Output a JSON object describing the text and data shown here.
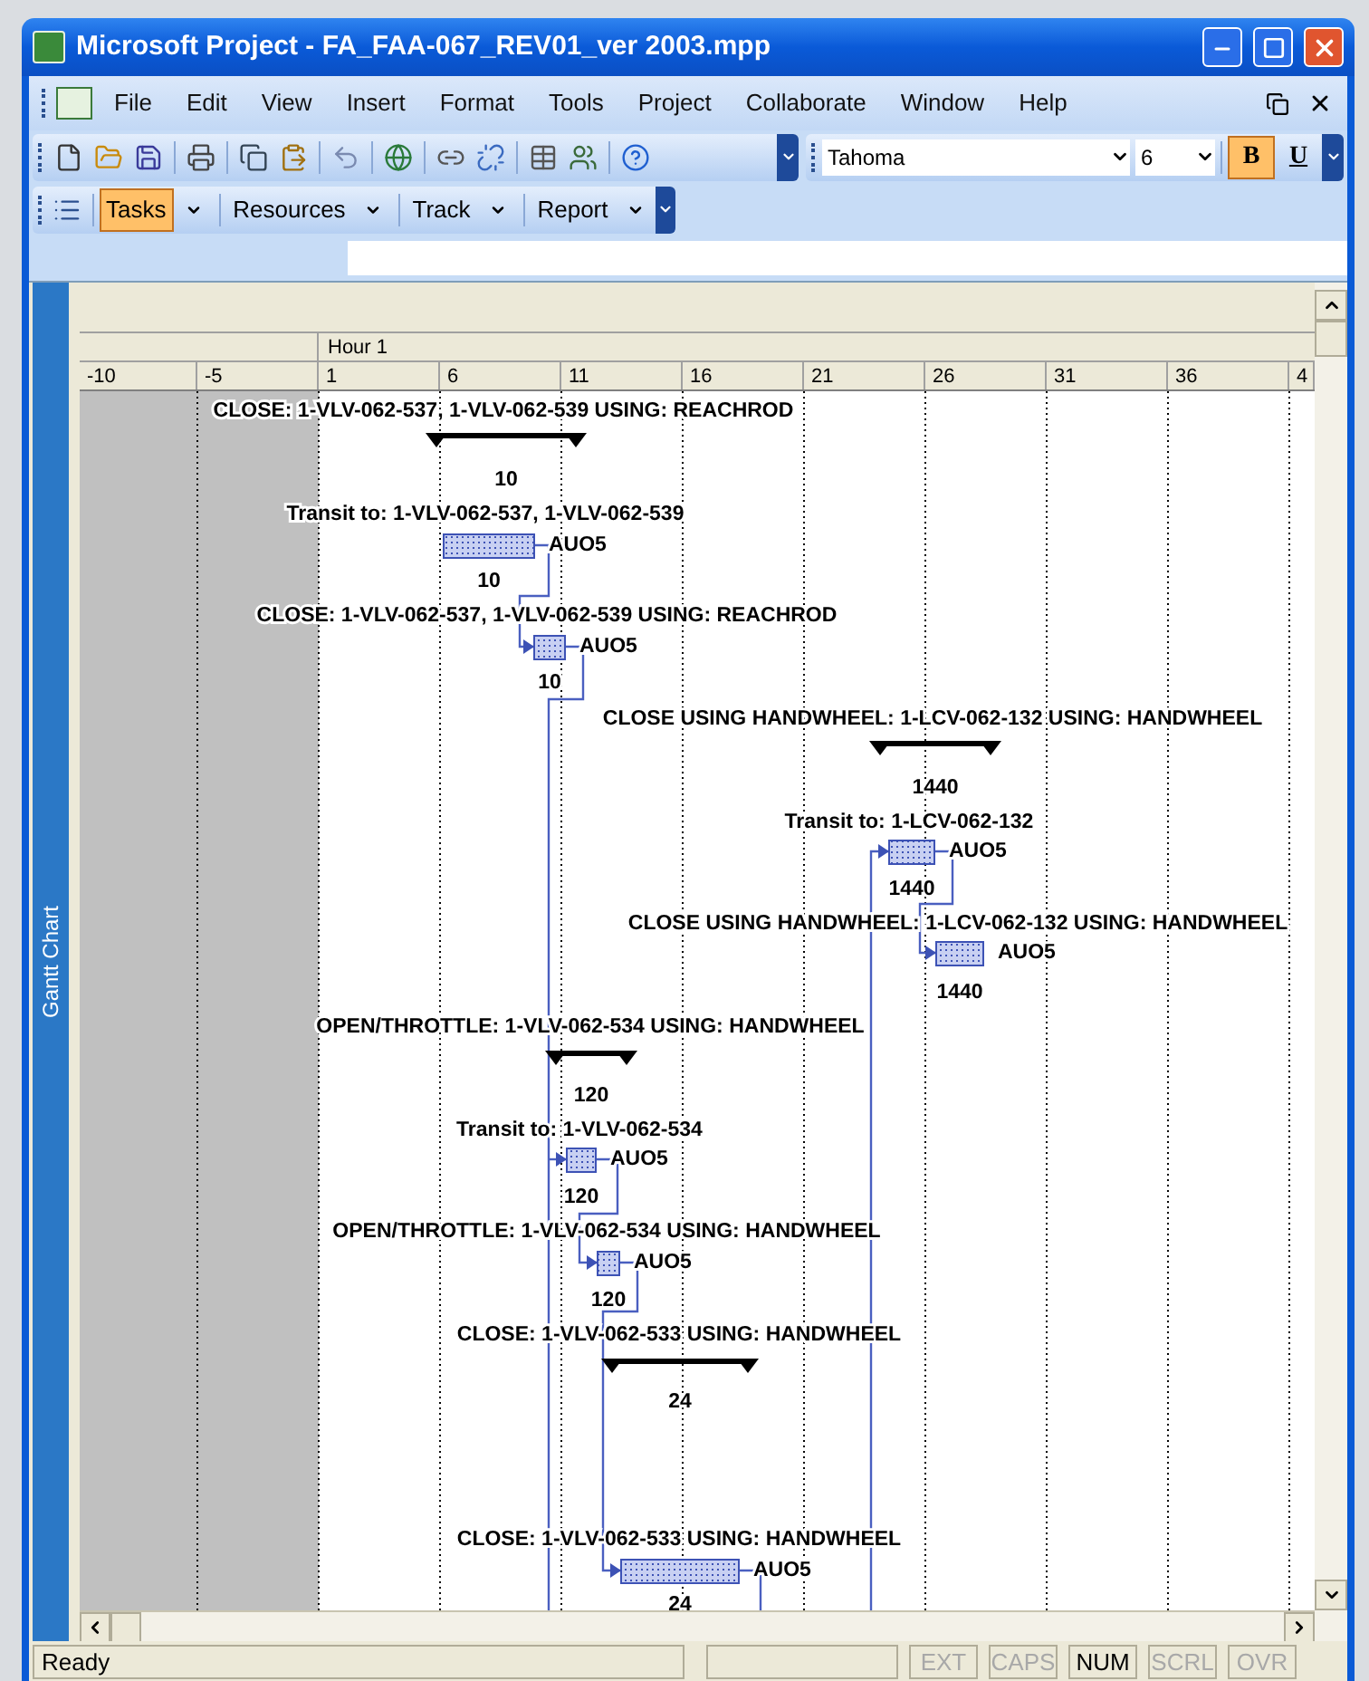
{
  "window": {
    "title": "Microsoft Project - FA_FAA-067_REV01_ver 2003.mpp"
  },
  "menu": [
    "File",
    "Edit",
    "View",
    "Insert",
    "Format",
    "Tools",
    "Project",
    "Collaborate",
    "Window",
    "Help"
  ],
  "formatting": {
    "font": "Tahoma",
    "size": "6",
    "buttons": [
      {
        "label": "B",
        "selected": true
      },
      {
        "label": "U",
        "selected": false
      }
    ]
  },
  "guide_bar": [
    {
      "label": "Tasks",
      "selected": true
    },
    {
      "label": "Resources",
      "selected": false
    },
    {
      "label": "Track",
      "selected": false
    },
    {
      "label": "Report",
      "selected": false
    }
  ],
  "view_label": "Gantt Chart",
  "timescale": {
    "middle_tier": "Hour 1",
    "ticks": [
      "-10",
      "-5",
      "1",
      "6",
      "11",
      "16",
      "21",
      "26",
      "31",
      "36",
      "4"
    ]
  },
  "tasks": [
    {
      "kind": "summary",
      "name": "CLOSE: 1-VLV-062-537, 1-VLV-062-539 USING: REACHROD",
      "duration": "10"
    },
    {
      "kind": "task",
      "name": "Transit to: 1-VLV-062-537, 1-VLV-062-539",
      "duration": "10",
      "resource": "AUO5"
    },
    {
      "kind": "task",
      "name": "CLOSE: 1-VLV-062-537, 1-VLV-062-539 USING: REACHROD",
      "duration": "10",
      "resource": "AUO5"
    },
    {
      "kind": "summary",
      "name": "CLOSE USING HANDWHEEL: 1-LCV-062-132 USING: HANDWHEEL",
      "duration": "1440"
    },
    {
      "kind": "task",
      "name": "Transit to: 1-LCV-062-132",
      "duration": "1440",
      "resource": "AUO5"
    },
    {
      "kind": "task",
      "name": "CLOSE USING HANDWHEEL: 1-LCV-062-132 USING: HANDWHEEL",
      "duration": "1440",
      "resource": "AUO5"
    },
    {
      "kind": "summary",
      "name": "OPEN/THROTTLE: 1-VLV-062-534 USING: HANDWHEEL",
      "duration": "120"
    },
    {
      "kind": "task",
      "name": "Transit to: 1-VLV-062-534",
      "duration": "120",
      "resource": "AUO5"
    },
    {
      "kind": "task",
      "name": "OPEN/THROTTLE: 1-VLV-062-534 USING: HANDWHEEL",
      "duration": "120",
      "resource": "AUO5"
    },
    {
      "kind": "summary",
      "name": "CLOSE: 1-VLV-062-533 USING: HANDWHEEL",
      "duration": "24"
    },
    {
      "kind": "task",
      "name": "CLOSE: 1-VLV-062-533 USING: HANDWHEEL",
      "duration": "24",
      "resource": "AUO5"
    }
  ],
  "status_bar": {
    "message": "Ready",
    "indicators": [
      {
        "label": "EXT",
        "on": false
      },
      {
        "label": "CAPS",
        "on": false
      },
      {
        "label": "NUM",
        "on": true
      },
      {
        "label": "SCRL",
        "on": false
      },
      {
        "label": "OVR",
        "on": false
      }
    ]
  }
}
